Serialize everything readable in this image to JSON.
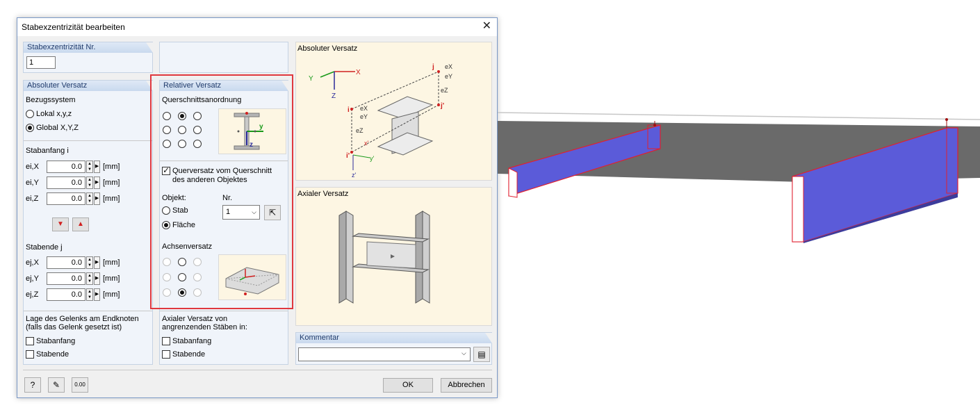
{
  "dialog": {
    "title": "Stabexzentrizität bearbeiten",
    "close_glyph": "✕"
  },
  "number_group": {
    "header": "Stabexzentrizität Nr.",
    "value": "1"
  },
  "absolute_group": {
    "header": "Absoluter Versatz",
    "reference_label": "Bezugssystem",
    "options": [
      "Lokal x,y,z",
      "Global X,Y,Z"
    ],
    "selected_option": "Global X,Y,Z",
    "start_label": "Stabanfang i",
    "start_rows": [
      {
        "label": "ei,X",
        "value": "0.0",
        "unit": "[mm]"
      },
      {
        "label": "ei,Y",
        "value": "0.0",
        "unit": "[mm]"
      },
      {
        "label": "ei,Z",
        "value": "0.0",
        "unit": "[mm]"
      }
    ],
    "end_label": "Stabende j",
    "end_rows": [
      {
        "label": "ej,X",
        "value": "0.0",
        "unit": "[mm]"
      },
      {
        "label": "ej,Y",
        "value": "0.0",
        "unit": "[mm]"
      },
      {
        "label": "ej,Z",
        "value": "0.0",
        "unit": "[mm]"
      }
    ],
    "hinge_label_1": "Lage des Gelenks am Endknoten",
    "hinge_label_2": "(falls das Gelenk gesetzt ist)",
    "hinge_start": "Stabanfang",
    "hinge_end": "Stabende"
  },
  "relative_group": {
    "header": "Relativer Versatz",
    "cross_section_label": "Querschnittsanordnung",
    "offset_checkbox_line1": "Querversatz vom Querschnitt",
    "offset_checkbox_line2": "des anderen Objektes",
    "object_label": "Objekt:",
    "object_options": [
      "Stab",
      "Fläche"
    ],
    "selected_object": "Fläche",
    "nr_label": "Nr.",
    "nr_value": "1",
    "axis_offset_label": "Achsenversatz",
    "axial_label_1": "Axialer Versatz von",
    "axial_label_2": "angrenzenden Stäben in:",
    "axial_start": "Stabanfang",
    "axial_end": "Stabende"
  },
  "pictures": {
    "absolute_title": "Absoluter Versatz",
    "axial_title": "Axialer Versatz"
  },
  "comment": {
    "header": "Kommentar",
    "value": ""
  },
  "buttons": {
    "ok": "OK",
    "cancel": "Abbrechen",
    "calc_icon_text": "0.00"
  }
}
